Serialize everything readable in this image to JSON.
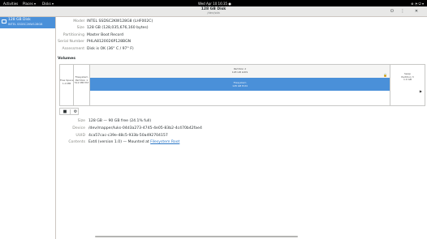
{
  "topbar": {
    "activities": "Activities",
    "places": "Places ▾",
    "app": "Disks ▾",
    "clock": "Wed Apr 10  16:35 ●",
    "status_icons": "⊕ ◔ ⏻ ▾"
  },
  "header": {
    "title": "128 GB Disk",
    "subtitle": "/dev/sda"
  },
  "sidebar": {
    "disks": [
      {
        "name": "128 GB Disk",
        "model": "INTEL SSDSC2KW128G8"
      }
    ]
  },
  "drive_info": [
    {
      "label": "Model",
      "value": "INTEL SSDSC2KW128G8 (LHF002C)"
    },
    {
      "label": "Size",
      "value": "128 GB (128,035,676,160 bytes)"
    },
    {
      "label": "Partitioning",
      "value": "Master Boot Record"
    },
    {
      "label": "Serial Number",
      "value": "PHLA8120026P128BGN"
    },
    {
      "label": "Assessment",
      "value": "Disk is OK (36° C / 97° F)"
    }
  ],
  "volumes": {
    "title": "Volumes",
    "segments": [
      {
        "label": "Free Space\n1.0 MB"
      },
      {
        "label": "Filesystem\nPartition 1\n512 MB FAT"
      },
      {
        "label": "Partition 2\n128 GB LUKS",
        "inner_label": "Filesystem\n128 GB Ext4"
      },
      {
        "label": "Swap\nPartition 3\n1.0 GB"
      }
    ]
  },
  "selected_volume": {
    "size_label": "Size",
    "size_value": "128 GB — 90 GB free (24.1% full)",
    "device_label": "Device",
    "device_value": "/dev/mapper/luks-04d3a273-4745-4e05-83b2-4c470b42fae4",
    "uuid_label": "UUID",
    "uuid_value": "4ca57cac-c39e-48c5-933b-50a492704157",
    "contents_label": "Contents",
    "contents_value": "Ext4 (version 1.0) — Mounted at ",
    "contents_link": "Filesystem Root"
  },
  "icons": {
    "lock": "lock-icon",
    "stop": "stop-icon",
    "settings": "gear-icon"
  }
}
